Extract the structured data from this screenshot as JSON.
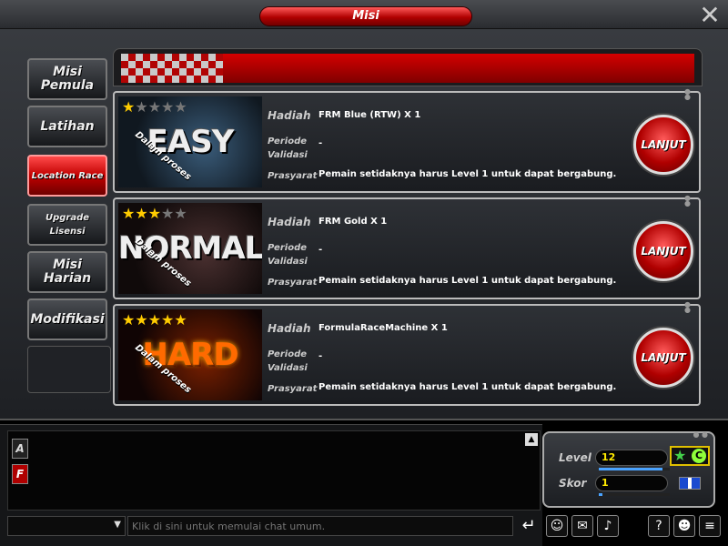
{
  "window": {
    "title": "Misi"
  },
  "tabs": [
    {
      "label": "Misi Pemula",
      "active": false
    },
    {
      "label": "Latihan",
      "active": false
    },
    {
      "label": "Location Race",
      "active": true
    },
    {
      "label": "Upgrade Lisensi",
      "active": false
    },
    {
      "label": "Misi Harian",
      "active": false
    },
    {
      "label": "Modifikasi",
      "active": false
    }
  ],
  "labels": {
    "reward": "Hadiah",
    "period": "Periode Validasi",
    "requirement": "Prasyarat",
    "status": "Dalam proses",
    "go": "LANJUT"
  },
  "missions": [
    {
      "difficulty": "EASY",
      "stars": 1,
      "max_stars": 5,
      "reward": "FRM Blue (RTW) X 1",
      "period": "-",
      "requirement": "Pemain setidaknya harus Level 1 untuk dapat bergabung."
    },
    {
      "difficulty": "NORMAL",
      "stars": 3,
      "max_stars": 5,
      "reward": "FRM Gold X 1",
      "period": "-",
      "requirement": "Pemain setidaknya harus Level 1 untuk dapat bergabung."
    },
    {
      "difficulty": "HARD",
      "stars": 5,
      "max_stars": 5,
      "reward": "FormulaRaceMachine X 1",
      "period": "-",
      "requirement": "Pemain setidaknya harus Level 1 untuk dapat bergabung."
    }
  ],
  "chat": {
    "placeholder": "Klik di sini untuk memulai chat umum.",
    "side_icons": [
      "A",
      "F"
    ]
  },
  "stats": {
    "level_label": "Level",
    "level_value": "12",
    "level_progress": 0.9,
    "score_label": "Skor",
    "score_value": "1",
    "score_progress": 0.05,
    "class_badge": "C"
  },
  "colors": {
    "accent_red": "#c00000",
    "star_on": "#ffcc00",
    "level_text": "#ffea00"
  }
}
